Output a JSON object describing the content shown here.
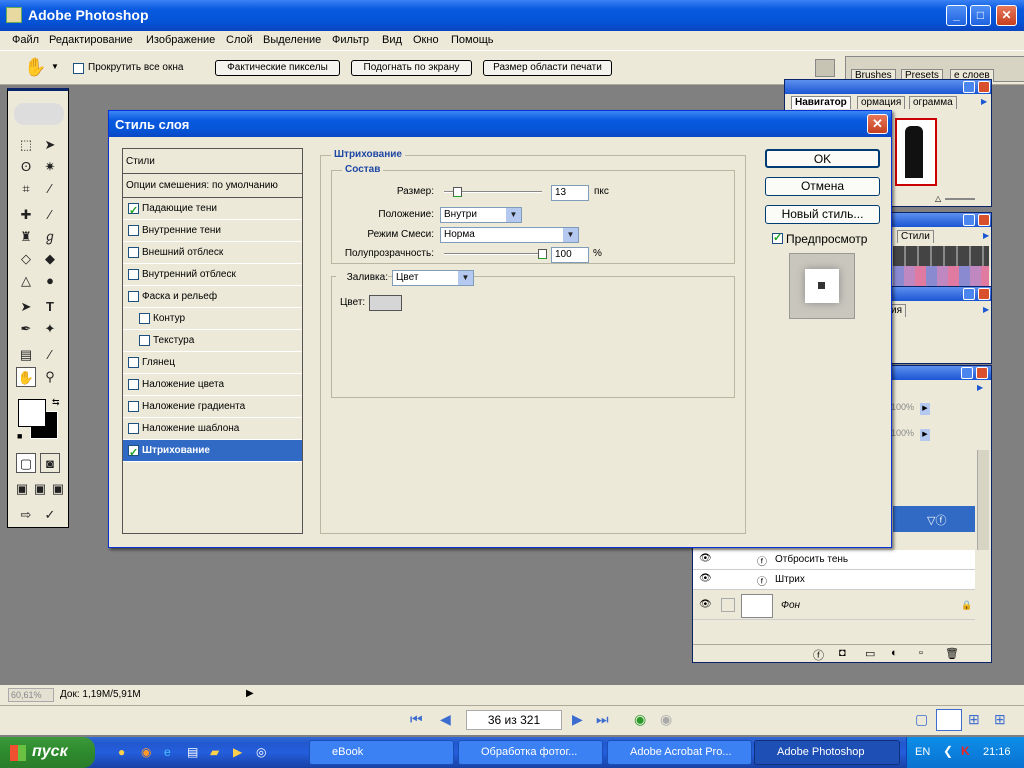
{
  "app": {
    "title": "Adobe Photoshop"
  },
  "menu": [
    "Файл",
    "Редактирование",
    "Изображение",
    "Слой",
    "Выделение",
    "Фильтр",
    "Вид",
    "Окно",
    "Помощь"
  ],
  "options": {
    "scroll_all": "Прокрутить все окна",
    "actual_pixels": "Фактические пикселы",
    "fit_screen": "Подогнать по экрану",
    "print_size": "Размер области печати",
    "tabs": [
      "Brushes",
      "Presets",
      "е слоев"
    ]
  },
  "panels": {
    "navigator_tabs": [
      "Навигатор",
      "ормация",
      "ограмма"
    ],
    "styles_tab": "Стили",
    "partial_tab": "ия",
    "pct1": "100%",
    "pct2": "100%",
    "layers": [
      {
        "name": "Отбросить тень"
      },
      {
        "name": "Штрих"
      },
      {
        "name": "Фон"
      }
    ]
  },
  "dialog": {
    "title": "Стиль слоя",
    "styles_header": "Стили",
    "blend_options": "Опции смешения: по умолчанию",
    "items": [
      {
        "label": "Падающие тени",
        "checked": true
      },
      {
        "label": "Внутренние тени",
        "checked": false
      },
      {
        "label": "Внешний отблеск",
        "checked": false
      },
      {
        "label": "Внутренний отблеск",
        "checked": false
      },
      {
        "label": "Фаска и рельеф",
        "checked": false
      },
      {
        "label": "Контур",
        "checked": false
      },
      {
        "label": "Текстура",
        "checked": false
      },
      {
        "label": "Глянец",
        "checked": false
      },
      {
        "label": "Наложение цвета",
        "checked": false
      },
      {
        "label": "Наложение градиента",
        "checked": false
      },
      {
        "label": "Наложение шаблона",
        "checked": false
      },
      {
        "label": "Штрихование",
        "checked": true
      }
    ],
    "section_title": "Штрихование",
    "group_title": "Состав",
    "size_label": "Размер:",
    "size_value": "13",
    "size_unit": "пкс",
    "size_fraction": 0.09,
    "position_label": "Положение:",
    "position_value": "Внутри",
    "blend_label": "Режим Смеси:",
    "blend_value": "Норма",
    "opacity_label": "Полупрозрачность:",
    "opacity_value": "100",
    "opacity_unit": "%",
    "fill_label": "Заливка:",
    "fill_value": "Цвет",
    "color_label": "Цвет:",
    "ok": "OK",
    "cancel": "Отмена",
    "new_style": "Новый стиль...",
    "preview": "Предпросмотр"
  },
  "status": {
    "zoom": "60,61%",
    "doc": "Док: 1,19M/5,91M"
  },
  "docnav": {
    "page": "36 из 321"
  },
  "taskbar": {
    "start": "пуск",
    "tasks": [
      "eBook",
      "Обработка фотог...",
      "Adobe Acrobat Pro...",
      "Adobe Photoshop"
    ],
    "lang": "EN",
    "time": "21:16"
  },
  "colors": {
    "xp_blue": "#0a5ae0",
    "face": "#ece9d8",
    "selection": "#316ac5"
  }
}
